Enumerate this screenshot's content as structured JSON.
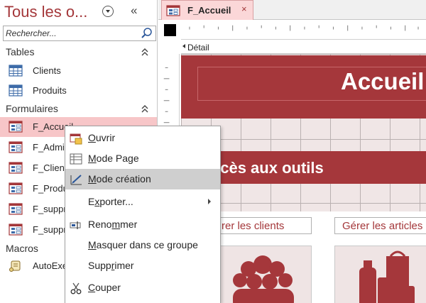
{
  "nav_pane": {
    "title": "Tous les o...",
    "search_placeholder": "Rechercher...",
    "groups": {
      "tables": {
        "label": "Tables",
        "items": [
          {
            "label": "Clients"
          },
          {
            "label": "Produits"
          }
        ]
      },
      "forms": {
        "label": "Formulaires",
        "items": [
          {
            "label": "F_Accueil"
          },
          {
            "label": "F_Admin"
          },
          {
            "label": "F_Clients"
          },
          {
            "label": "F_Produ"
          },
          {
            "label": "F_suppr_"
          },
          {
            "label": "F_suppr_"
          }
        ]
      },
      "macros": {
        "label": "Macros",
        "items": [
          {
            "label": "AutoExe"
          }
        ]
      }
    }
  },
  "document_tab": {
    "label": "F_Accueil",
    "close_glyph": "×"
  },
  "design_view": {
    "section_label": "Détail",
    "banner_title": "Accueil",
    "bar_title": "ccès aux outils",
    "button_left": "rer les clients",
    "button_right": "Gérer les articles"
  },
  "context_menu": {
    "items": [
      {
        "pre": "",
        "key": "O",
        "post": "uvrir"
      },
      {
        "pre": "",
        "key": "M",
        "post": "ode Page"
      },
      {
        "pre": "",
        "key": "M",
        "post": "ode création"
      },
      {
        "pre": "E",
        "key": "x",
        "post": "porter..."
      },
      {
        "pre": "Reno",
        "key": "m",
        "post": "mer"
      },
      {
        "pre": "",
        "key": "M",
        "post": "asquer dans ce groupe"
      },
      {
        "pre": "Supp",
        "key": "r",
        "post": "imer"
      },
      {
        "pre": "",
        "key": "C",
        "post": "ouper"
      }
    ]
  },
  "colors": {
    "accent": "#a4373a",
    "selection": "#f7c6c8",
    "menu_hover": "#cfcfcf"
  }
}
